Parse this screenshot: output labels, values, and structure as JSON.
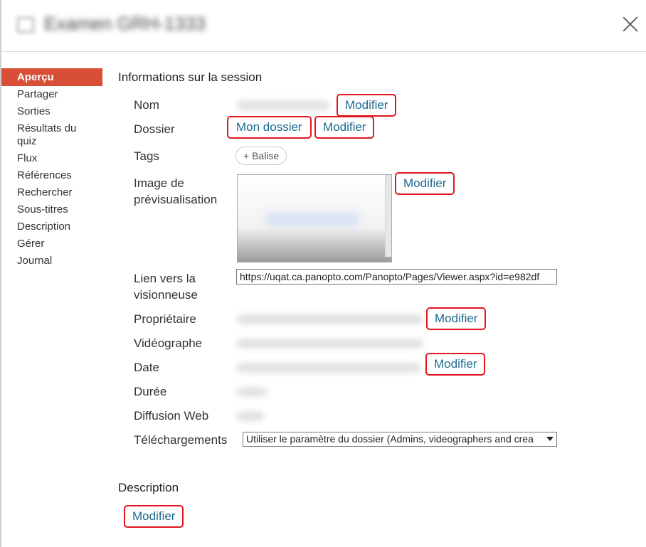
{
  "header": {
    "title": "Examen GRH-1333",
    "icon": "panel-icon",
    "close_icon": "close-icon"
  },
  "sidebar": {
    "items": [
      {
        "label": "Aperçu",
        "active": true
      },
      {
        "label": "Partager"
      },
      {
        "label": "Sorties"
      },
      {
        "label": "Résultats du quiz"
      },
      {
        "label": "Flux"
      },
      {
        "label": "Références"
      },
      {
        "label": "Rechercher"
      },
      {
        "label": "Sous-titres"
      },
      {
        "label": "Description"
      },
      {
        "label": "Gérer"
      },
      {
        "label": "Journal"
      }
    ]
  },
  "session": {
    "heading": "Informations sur la session",
    "labels": {
      "name": "Nom",
      "folder": "Dossier",
      "tags": "Tags",
      "preview": "Image de prévisualisation",
      "viewer_link": "Lien vers la visionneuse",
      "owner": "Propriétaire",
      "videographer": "Vidéographe",
      "date": "Date",
      "duration": "Durée",
      "webcast": "Diffusion Web",
      "downloads": "Téléchargements"
    },
    "modify_label": "Modifier",
    "folder_link": "Mon dossier",
    "tag_button": "+ Balise",
    "viewer_url": "https://uqat.ca.panopto.com/Panopto/Pages/Viewer.aspx?id=e982df",
    "downloads_value": "Utiliser le paramètre du dossier (Admins, videographers and crea"
  },
  "description": {
    "heading": "Description",
    "modify_label": "Modifier"
  },
  "colors": {
    "accent": "#d84e36",
    "link": "#1b6b8f",
    "highlight": "#e2161e"
  }
}
